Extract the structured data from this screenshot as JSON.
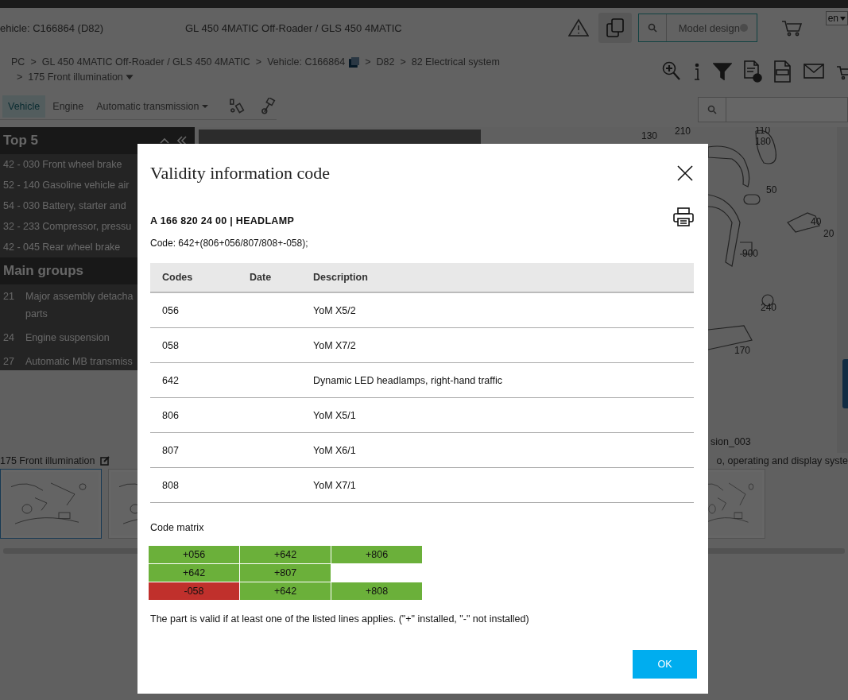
{
  "header": {
    "vehicle": "ehicle: C166864 (D82)",
    "model": "GL 450 4MATIC Off-Roader / GLS 450 4MATIC",
    "search_value": "Model design",
    "language": "en"
  },
  "breadcrumbs": [
    {
      "label": "PC",
      "kind": "link"
    },
    {
      "separator": ">",
      "label": "GL 450 4MATIC Off-Roader / GLS 450 4MATIC",
      "kind": "link"
    },
    {
      "separator": ">",
      "label": "Vehicle: C166864",
      "kind": "copy"
    },
    {
      "separator": ">",
      "label": "D82",
      "kind": "link"
    },
    {
      "separator": ">",
      "label": "82 Electrical system",
      "kind": "link"
    },
    {
      "separator": ">",
      "label": "175 Front illumination",
      "kind": "menu"
    }
  ],
  "tabs": [
    {
      "label": "Vehicle",
      "selected": true,
      "has_menu": false
    },
    {
      "label": "Engine",
      "selected": false,
      "has_menu": false
    },
    {
      "label": "Automatic transmission",
      "selected": false,
      "has_menu": true
    }
  ],
  "sidebar": {
    "top_title": "Top 5",
    "top_items": [
      "42 - 030 Front wheel brake",
      "52 - 140 Gasoline vehicle air",
      "54 - 030 Battery, starter and",
      "32 - 233 Compressor, pressu",
      "42 - 045 Rear wheel brake"
    ],
    "groups_title": "Main groups",
    "groups": [
      {
        "number": "21",
        "lines": [
          "Major assembly detacha",
          "parts"
        ]
      },
      {
        "number": "24",
        "lines": [
          "Engine suspension"
        ]
      },
      {
        "number": "27",
        "lines": [
          "Automatic MB transmiss"
        ]
      }
    ]
  },
  "diagram": {
    "labels": [
      "130",
      "210",
      "110",
      "180",
      "50",
      "40",
      "20",
      "900",
      "240",
      "170"
    ],
    "caption": "sion_003"
  },
  "thumbnails": {
    "left_title": "175 Front illumination",
    "right_title": "o, operating and display syste",
    "items": [
      {
        "kind": "picture",
        "selected": true
      },
      {
        "kind": "picture",
        "selected": false
      },
      {
        "kind": "picture",
        "selected": false
      }
    ]
  },
  "dialog": {
    "title": "Validity information code",
    "part": "A 166 820 24 00 | HEADLAMP",
    "code": "Code: 642+(806+056/807/808+-058);",
    "columns": [
      "Codes",
      "Date",
      "Description"
    ],
    "rows": [
      {
        "code": "056",
        "date": "",
        "description": "YoM X5/2"
      },
      {
        "code": "058",
        "date": "",
        "description": "YoM X7/2"
      },
      {
        "code": "642",
        "date": "",
        "description": "Dynamic LED headlamps, right-hand traffic"
      },
      {
        "code": "806",
        "date": "",
        "description": "YoM X5/1"
      },
      {
        "code": "807",
        "date": "",
        "description": "YoM X6/1"
      },
      {
        "code": "808",
        "date": "",
        "description": "YoM X7/1"
      }
    ],
    "matrix_title": "Code matrix",
    "matrix": [
      [
        {
          "code": "+056",
          "installed": true
        },
        {
          "code": "+642",
          "installed": true
        },
        {
          "code": "+806",
          "installed": true
        }
      ],
      [
        {
          "code": "+642",
          "installed": true
        },
        {
          "code": "+807",
          "installed": true
        }
      ],
      [
        {
          "code": "-058",
          "installed": false
        },
        {
          "code": "+642",
          "installed": true
        },
        {
          "code": "+808",
          "installed": true
        }
      ]
    ],
    "note": "The part is valid if at least one of the listed lines applies. (\"+\" installed, \"-\" not installed)",
    "ok_button": "OK"
  }
}
